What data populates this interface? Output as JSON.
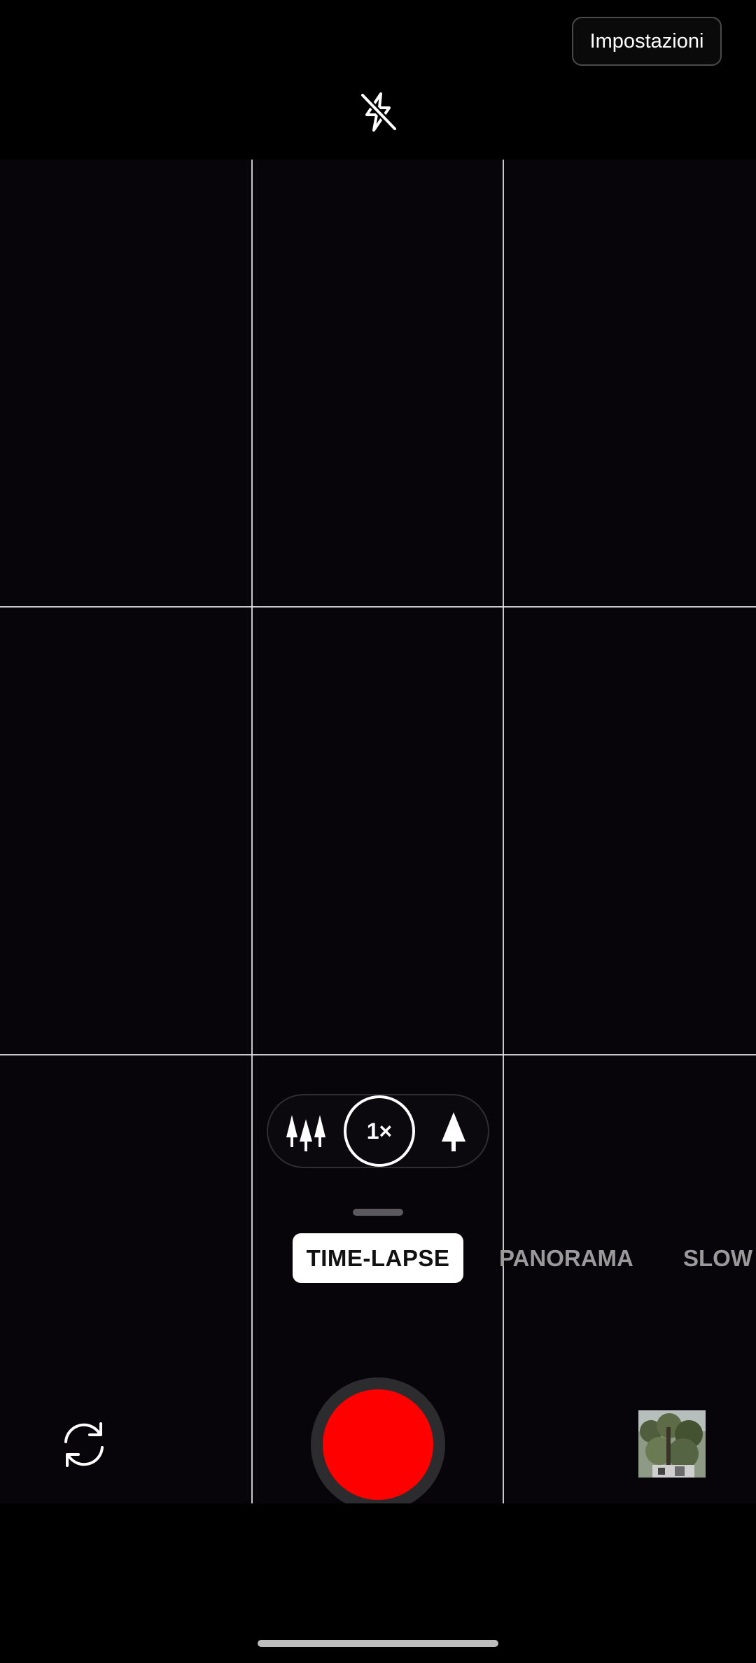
{
  "header": {
    "settings_label": "Impostazioni",
    "flash_icon": "flash-off-icon"
  },
  "zoom": {
    "wide_icon": "trees-wide-icon",
    "current_label": "1×",
    "tele_icon": "tree-tele-icon"
  },
  "modes": {
    "active": "TIME-LAPSE",
    "items": [
      "PANORAMA",
      "SLOW MOTION"
    ]
  },
  "controls": {
    "switch_camera_icon": "switch-camera-icon",
    "shutter_color": "#ff0000",
    "gallery_icon": "gallery-thumbnail"
  },
  "colors": {
    "background": "#000000",
    "viewfinder": "#07040a",
    "accent_record": "#ff0000"
  }
}
